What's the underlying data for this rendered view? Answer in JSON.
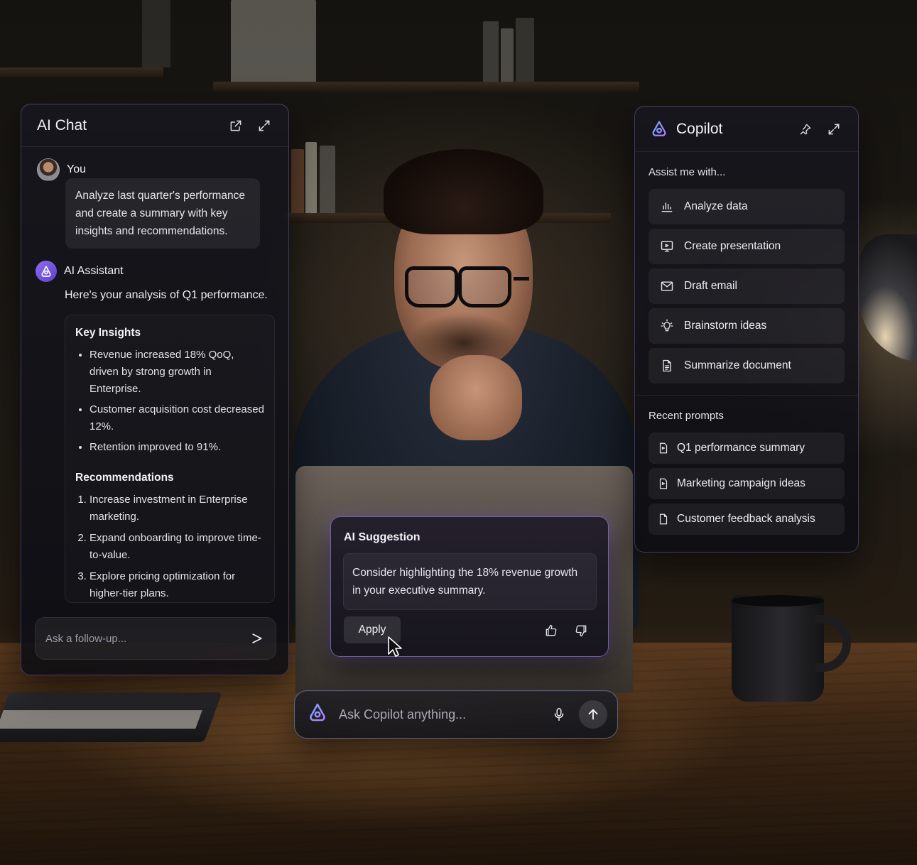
{
  "chat": {
    "title": "AI Chat",
    "user": {
      "name": "You",
      "message": "Analyze last quarter's performance and create a summary with key insights and recommendations."
    },
    "assistant": {
      "name": "AI Assistant",
      "intro": "Here's your analysis of Q1 performance.",
      "insights_heading": "Key Insights",
      "insights": [
        "Revenue increased 18% QoQ, driven by strong growth in Enterprise.",
        "Customer acquisition cost decreased 12%.",
        "Retention improved to 91%."
      ],
      "recommendations_heading": "Recommendations",
      "recommendations": [
        "Increase investment in Enterprise marketing.",
        "Expand onboarding to improve time-to-value.",
        "Explore pricing optimization for higher-tier plans."
      ]
    },
    "input_placeholder": "Ask a follow-up..."
  },
  "copilot": {
    "title": "Copilot",
    "assist_heading": "Assist me with...",
    "assist_items": [
      {
        "label": "Analyze data",
        "icon": "bar-chart-icon"
      },
      {
        "label": "Create presentation",
        "icon": "presentation-icon"
      },
      {
        "label": "Draft email",
        "icon": "mail-icon"
      },
      {
        "label": "Brainstorm ideas",
        "icon": "lightbulb-icon"
      },
      {
        "label": "Summarize document",
        "icon": "document-icon"
      }
    ],
    "recent_heading": "Recent prompts",
    "recent_items": [
      {
        "label": "Q1 performance summary"
      },
      {
        "label": "Marketing campaign ideas"
      },
      {
        "label": "Customer feedback analysis"
      }
    ]
  },
  "suggestion": {
    "title": "AI Suggestion",
    "body": "Consider highlighting the 18% revenue growth in your executive summary.",
    "apply_label": "Apply"
  },
  "askbar": {
    "placeholder": "Ask Copilot anything..."
  },
  "colors": {
    "accent": "#8b6cf0",
    "panel_border": "#9682dc"
  }
}
